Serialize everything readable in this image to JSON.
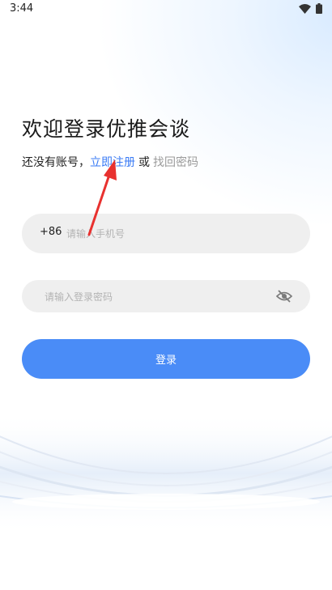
{
  "status_bar": {
    "time": "3:44",
    "icons": [
      "wifi-icon",
      "battery-icon"
    ]
  },
  "welcome": {
    "title": "欢迎登录优推会谈"
  },
  "register": {
    "prefix": "还没有账号，",
    "register_link": "立即注册",
    "or": "或",
    "find_password": "找回密码"
  },
  "phone": {
    "country_code": "+86",
    "placeholder": "请输入手机号",
    "value": ""
  },
  "password": {
    "placeholder": "请输入登录密码",
    "value": "",
    "toggle_icon": "eye-off-icon"
  },
  "login": {
    "label": "登录"
  },
  "colors": {
    "accent": "#4a8cf7",
    "link": "#3a7bf5",
    "annotation_arrow": "#e8312f"
  }
}
